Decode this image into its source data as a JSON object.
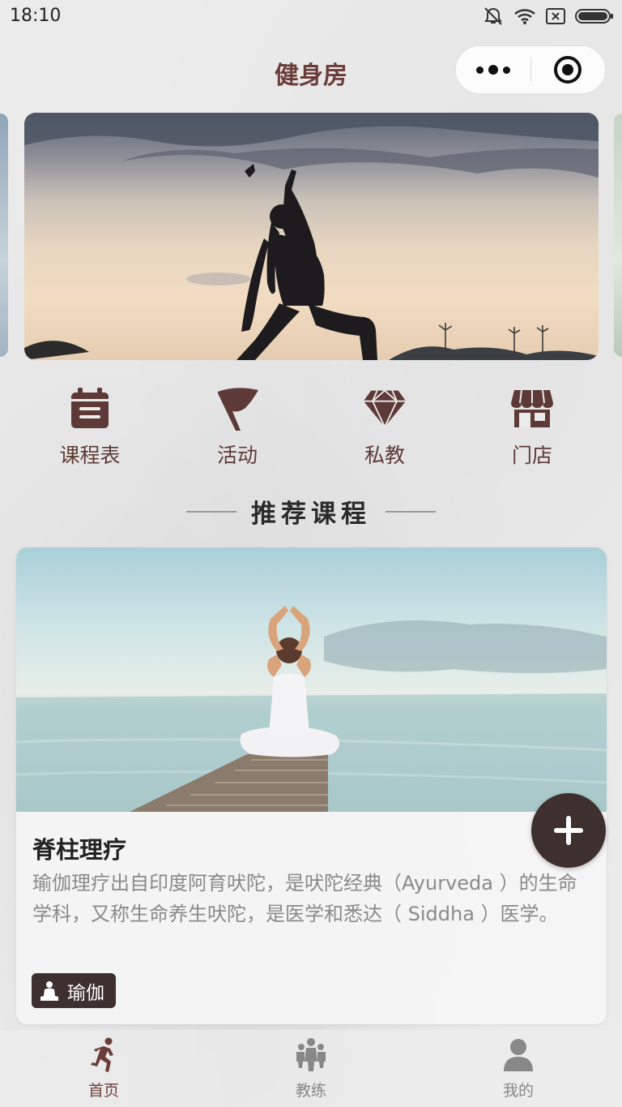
{
  "status_bar": {
    "time": "18:10"
  },
  "nav": {
    "title": "健身房"
  },
  "quick_menu": [
    {
      "label": "课程表",
      "icon": "calendar-icon"
    },
    {
      "label": "活动",
      "icon": "flag-icon"
    },
    {
      "label": "私教",
      "icon": "diamond-icon"
    },
    {
      "label": "门店",
      "icon": "store-icon"
    }
  ],
  "section": {
    "title": "推荐课程"
  },
  "course": {
    "title": "脊柱理疗",
    "description": "瑜伽理疗出自印度阿育吠陀，是吠陀经典（Ayurveda ）的生命学科，又称生命养生吠陀，是医学和悉达（ Siddha ）医学。",
    "tag": "瑜伽"
  },
  "tabs": [
    {
      "label": "首页",
      "icon": "running-icon",
      "active": true
    },
    {
      "label": "教练",
      "icon": "coach-icon",
      "active": false
    },
    {
      "label": "我的",
      "icon": "user-icon",
      "active": false
    }
  ],
  "colors": {
    "accent": "#6b3d3a",
    "dark": "#3e302f"
  }
}
